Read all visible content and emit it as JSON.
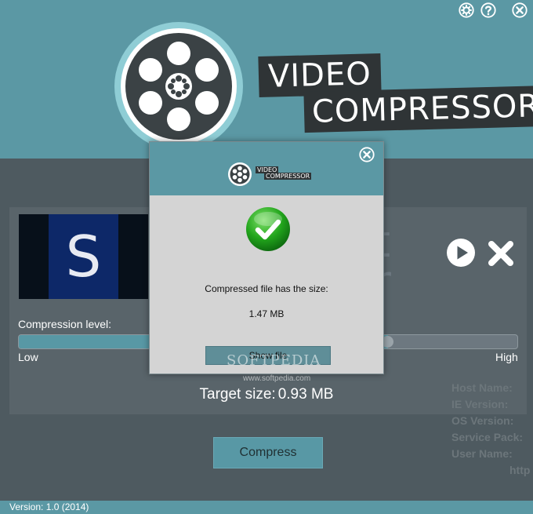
{
  "app": {
    "title_line1": "VIDEO",
    "title_line2": "COMPRESSOR",
    "icons": [
      "settings-icon",
      "help-icon",
      "close-icon"
    ]
  },
  "preview": {
    "thumbnail_letter": "S",
    "ghost_letters": [
      "t",
      "r"
    ]
  },
  "compression": {
    "label": "Compression level:",
    "low": "Low",
    "high": "High",
    "level_fraction": 0.74,
    "accent_color": "#5898a5"
  },
  "target": {
    "label": "Target size:",
    "value": "0.93 MB"
  },
  "sysinfo": {
    "lines": [
      "Host Name:",
      "IE Version:",
      "OS Version:",
      "Service Pack:",
      "User Name:",
      "http"
    ]
  },
  "compress_button": "Compress",
  "footer": {
    "version": "Version:  1.0 (2014)"
  },
  "dialog": {
    "logo_line1": "VIDEO",
    "logo_line2": "COMPRESSOR",
    "message": "Compressed file has the size:",
    "size": "1.47 MB",
    "show_file_button": "Show file"
  },
  "watermark": {
    "main": "SOFTPEDIA",
    "sub": "www.softpedia.com"
  }
}
